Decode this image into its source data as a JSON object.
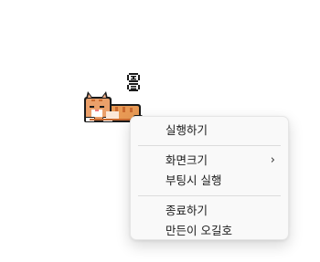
{
  "pet": {
    "sleep_symbol": "zz",
    "icon": "sleeping-cat-icon"
  },
  "context_menu": {
    "items": [
      {
        "label": "실행하기"
      },
      {
        "label": "화면크기",
        "submenu_arrow": "›"
      },
      {
        "label": "부팅시 실행"
      },
      {
        "label": "종료하기"
      },
      {
        "label": "만든이 오길호"
      }
    ]
  },
  "colors": {
    "menu_bg": "#f9f9f9",
    "cat_orange": "#e89a55",
    "cat_outline": "#1b1b1b"
  }
}
